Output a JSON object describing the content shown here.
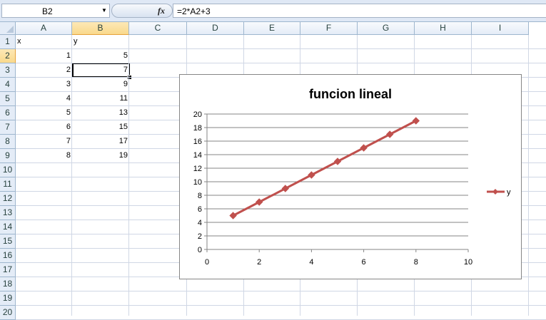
{
  "formula_bar": {
    "name_box": "B2",
    "fx_label": "fx",
    "formula": "=2*A2+3"
  },
  "columns": [
    "A",
    "B",
    "C",
    "D",
    "E",
    "F",
    "G",
    "H",
    "I"
  ],
  "selected_column": "B",
  "rows": [
    "1",
    "2",
    "3",
    "4",
    "5",
    "6",
    "7",
    "8",
    "9",
    "10",
    "11",
    "12",
    "13",
    "14",
    "15",
    "16",
    "17",
    "18",
    "19",
    "20"
  ],
  "selected_row": "2",
  "cells": {
    "A1": "x",
    "B1": "y",
    "A2": "1",
    "B2": "5",
    "A3": "2",
    "B3": "7",
    "A4": "3",
    "B4": "9",
    "A5": "4",
    "B5": "11",
    "A6": "5",
    "B6": "13",
    "A7": "6",
    "B7": "15",
    "A8": "7",
    "B8": "17",
    "A9": "8",
    "B9": "19"
  },
  "colors": {
    "series": "#c0504d",
    "header_bg": "#e4ecf7",
    "selected_header": "#f9d98c",
    "gridline": "#d0d7e5"
  },
  "chart_data": {
    "type": "scatter",
    "title": "funcion lineal",
    "xlabel": "",
    "ylabel": "",
    "xlim": [
      0,
      10
    ],
    "ylim": [
      0,
      20
    ],
    "xticks": [
      0,
      2,
      4,
      6,
      8,
      10
    ],
    "yticks": [
      0,
      2,
      4,
      6,
      8,
      10,
      12,
      14,
      16,
      18,
      20
    ],
    "grid": "horizontal",
    "legend_position": "right",
    "series": [
      {
        "name": "y",
        "x": [
          1,
          2,
          3,
          4,
          5,
          6,
          7,
          8
        ],
        "y": [
          5,
          7,
          9,
          11,
          13,
          15,
          17,
          19
        ],
        "marker": "diamond",
        "line": true
      }
    ]
  }
}
